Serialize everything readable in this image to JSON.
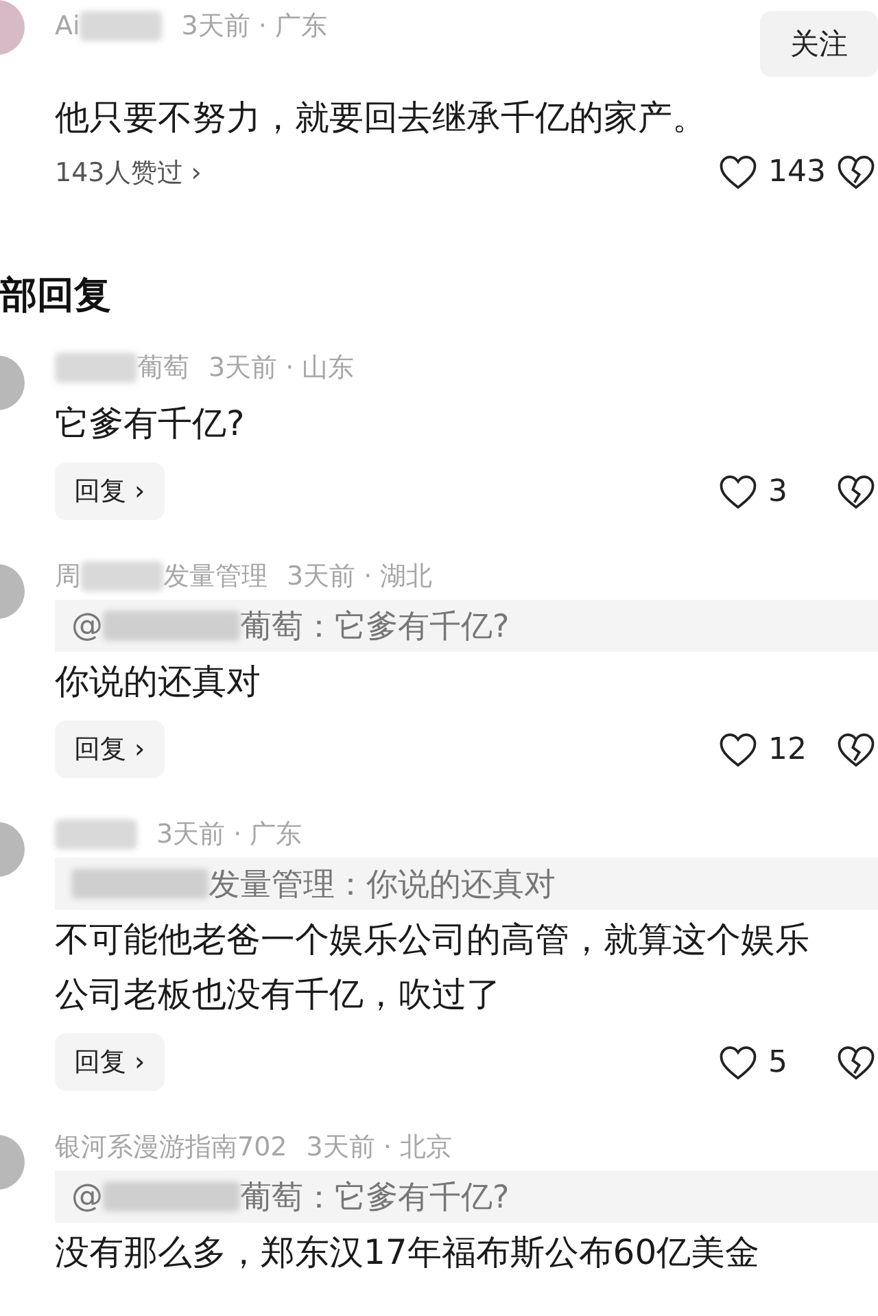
{
  "top_comment": {
    "name": [
      {
        "kind": "text",
        "text": "Ai"
      },
      {
        "kind": "redacted"
      }
    ],
    "time_location": "3天前 · 广东",
    "follow_button": "关注",
    "text": "他只要不努力，就要回去继承千亿的家产。",
    "liked_by": "143人赞过 ›",
    "likes": "143"
  },
  "section_title": "部回复",
  "replies": [
    {
      "name": [
        {
          "kind": "redacted"
        },
        {
          "kind": "text",
          "text": "葡萄"
        }
      ],
      "time_location": "3天前 · 山东",
      "text": "它爹有千亿?",
      "reply_button": "回复 ›",
      "likes": "3"
    },
    {
      "name": [
        {
          "kind": "text",
          "text": "周"
        },
        {
          "kind": "redacted"
        },
        {
          "kind": "text",
          "text": "发量管理"
        }
      ],
      "time_location": "3天前 · 湖北",
      "quote": [
        {
          "kind": "text",
          "text": "@"
        },
        {
          "kind": "redacted"
        },
        {
          "kind": "text",
          "text": "葡萄：它爹有千亿?"
        }
      ],
      "text": "你说的还真对",
      "reply_button": "回复 ›",
      "likes": "12"
    },
    {
      "name": [
        {
          "kind": "redacted"
        }
      ],
      "time_location": "3天前 · 广东",
      "quote": [
        {
          "kind": "redacted"
        },
        {
          "kind": "text",
          "text": "发量管理：你说的还真对"
        }
      ],
      "text": "不可能他老爸一个娱乐公司的高管，就算这个娱乐公司老板也没有千亿，吹过了",
      "reply_button": "回复 ›",
      "likes": "5"
    },
    {
      "name": [
        {
          "kind": "text",
          "text": "银河系漫游指南702"
        }
      ],
      "time_location": "3天前 · 北京",
      "quote": [
        {
          "kind": "text",
          "text": "@"
        },
        {
          "kind": "redacted"
        },
        {
          "kind": "text",
          "text": "葡萄：它爹有千亿?"
        }
      ],
      "text": "没有那么多，郑东汉17年福布斯公布60亿美金"
    }
  ]
}
